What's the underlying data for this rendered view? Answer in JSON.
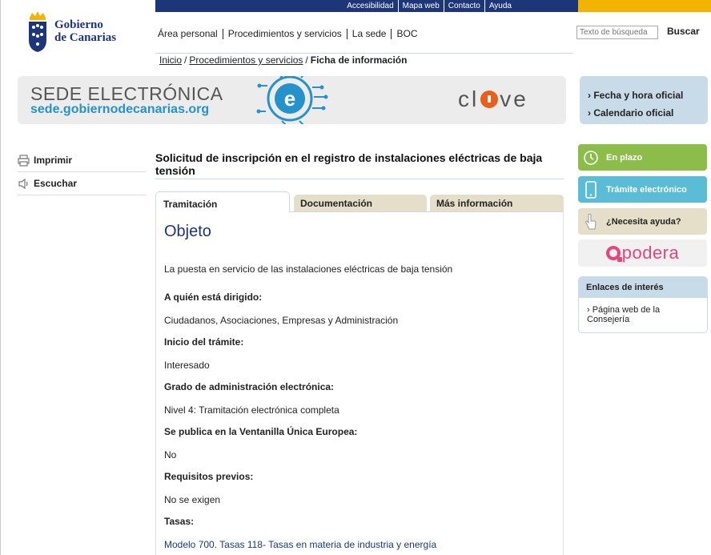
{
  "topbar": {
    "items": [
      "Accesibilidad",
      "Mapa web",
      "Contacto",
      "Ayuda"
    ]
  },
  "logo": {
    "line1": "Gobierno",
    "line2": "de Canarias"
  },
  "nav": {
    "items": [
      "Área personal",
      "Procedimientos y servicios",
      "La sede",
      "BOC"
    ]
  },
  "search": {
    "placeholder": "Texto de búsqueda",
    "button": "Buscar"
  },
  "breadcrumb": {
    "home": "Inicio",
    "section": "Procedimientos y servicios",
    "current": "Ficha de información",
    "sep": "/"
  },
  "banner": {
    "title": "SEDE ELECTRÓNICA",
    "url": "sede.gobiernodecanarias.org",
    "clave_left": "cl",
    "clave_right": "ve"
  },
  "infobox": {
    "items": [
      "› Fecha y hora oficial",
      "› Calendario oficial"
    ]
  },
  "tools": {
    "print": "Imprimir",
    "listen": "Escuchar"
  },
  "page": {
    "title": "Solicitud de inscripción en el registro de instalaciones eléctricas de baja tensión"
  },
  "tabs": [
    "Tramitación",
    "Documentación",
    "Más información"
  ],
  "content": {
    "heading": "Objeto",
    "objeto_text": "La puesta en servicio de las instalaciones eléctricas de baja tensión",
    "sections": [
      {
        "label": "A quién está dirigido:",
        "value": "Ciudadanos, Asociaciones, Empresas y Administración"
      },
      {
        "label": "Inicio del trámite:",
        "value": "Interesado"
      },
      {
        "label": "Grado de administración electrónica:",
        "value": "Nivel 4: Tramitación electrónica completa"
      },
      {
        "label": "Se publica en la Ventanilla Única Europea:",
        "value": "No"
      },
      {
        "label": "Requisitos previos:",
        "value": "No se exigen"
      },
      {
        "label": "Tasas:",
        "value": "Modelo 700. Tasas 118- Tasas en materia de industria y energía"
      }
    ]
  },
  "sidebar": {
    "en_plazo": "En plazo",
    "tramite": "Trámite electrónico",
    "ayuda": "¿Necesita ayuda?",
    "apodera": "podera",
    "enlaces_title": "Enlaces de interés",
    "enlaces_item": "› Página web de la Consejería"
  },
  "colors": {
    "navy": "#1d3679",
    "yellow": "#f2b400",
    "green": "#8cbd4a",
    "cyan": "#5bbcd6",
    "tan": "#e5dfc9"
  }
}
